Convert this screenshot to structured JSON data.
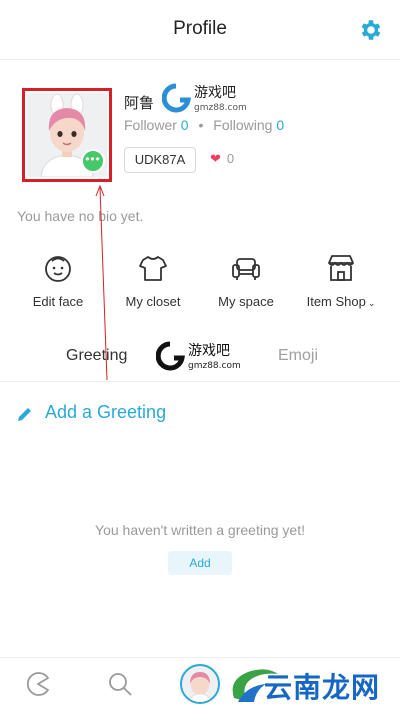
{
  "header": {
    "title": "Profile",
    "settings_icon": "gear-icon"
  },
  "profile": {
    "username": "阿鲁",
    "follower_label": "Follower",
    "follower_count": "0",
    "following_label": "Following",
    "following_count": "0",
    "user_code": "UDK87A",
    "likes_count": "0",
    "bio": "You have no bio yet.",
    "avatar_badge": "•••"
  },
  "actions": [
    {
      "label": "Edit face",
      "icon": "face-icon"
    },
    {
      "label": "My closet",
      "icon": "shirt-icon"
    },
    {
      "label": "My space",
      "icon": "sofa-icon"
    },
    {
      "label": "Item Shop",
      "icon": "shop-icon"
    }
  ],
  "tabs": [
    {
      "label": "Greeting",
      "active": true
    },
    {
      "label": "Emoji",
      "active": false
    }
  ],
  "greeting": {
    "add_label": "Add a Greeting",
    "empty_message": "You haven't written a greeting yet!",
    "add_button": "Add"
  },
  "watermarks": {
    "logo_text": "游戏吧",
    "logo_url": "gmz88.com",
    "corner_text": "云南龙网"
  },
  "bottom_nav": [
    "home-icon",
    "search-icon",
    "profile-avatar"
  ],
  "colors": {
    "accent": "#2aa9d6",
    "highlight_border": "#d61f26",
    "badge": "#47c96b",
    "heart": "#e8435e"
  }
}
